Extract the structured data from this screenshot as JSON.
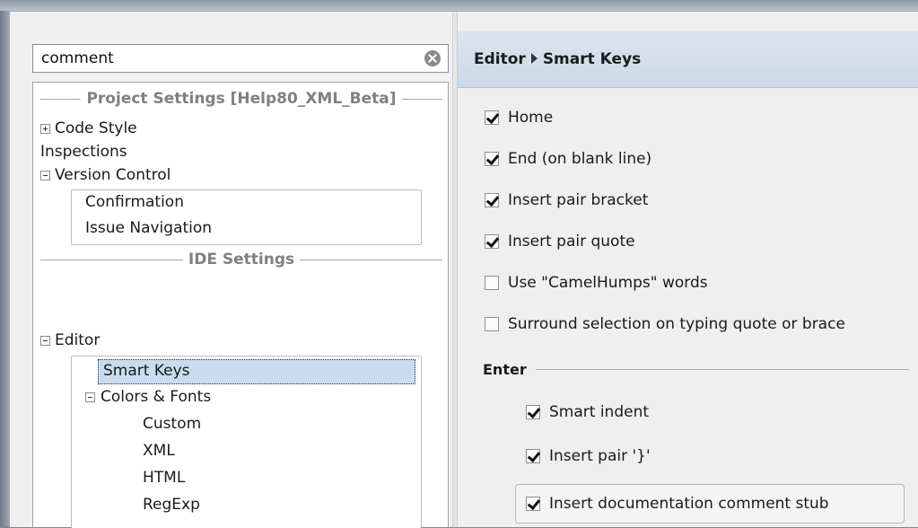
{
  "search": {
    "value": "comment"
  },
  "tree": {
    "project_settings_label": "Project Settings [Help80_XML_Beta]",
    "ide_settings_label": "IDE Settings",
    "items": {
      "code_style": "Code Style",
      "inspections": "Inspections",
      "version_control": "Version Control",
      "confirmation": "Confirmation",
      "issue_navigation": "Issue Navigation",
      "editor": "Editor",
      "smart_keys": "Smart Keys",
      "colors_fonts": "Colors & Fonts",
      "custom": "Custom",
      "xml": "XML",
      "html": "HTML",
      "regexp": "RegExp"
    }
  },
  "header": {
    "crumb_1": "Editor",
    "crumb_2": "Smart Keys"
  },
  "options": [
    {
      "label": "Home",
      "checked": true
    },
    {
      "label": "End (on blank line)",
      "checked": true
    },
    {
      "label": "Insert pair bracket",
      "checked": true
    },
    {
      "label": "Insert pair quote",
      "checked": true
    },
    {
      "label": "Use \"CamelHumps\" words",
      "checked": false
    },
    {
      "label": "Surround selection on typing quote or brace",
      "checked": false
    }
  ],
  "enter": {
    "label": "Enter",
    "options": [
      {
        "label": "Smart indent",
        "checked": true
      },
      {
        "label": "Insert pair '}'",
        "checked": true
      },
      {
        "label": "Insert documentation comment stub",
        "checked": true
      }
    ]
  },
  "colors": {
    "selection": "#c7dcef",
    "header": "#ccd9e6"
  }
}
